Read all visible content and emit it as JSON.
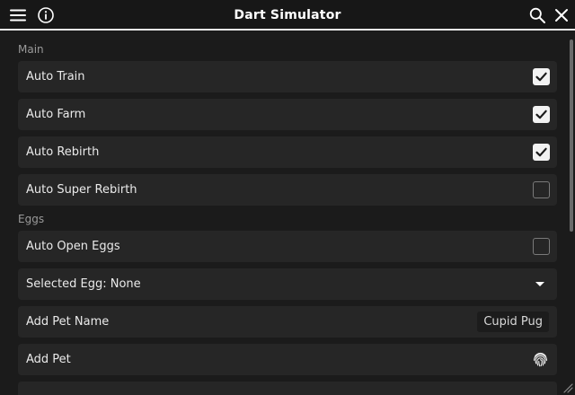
{
  "window": {
    "title": "Dart Simulator",
    "accent_color": "#e9e9e9",
    "background_color": "#1b1b1b",
    "row_color": "#262626"
  },
  "header_icons": [
    "menu-icon",
    "info-icon",
    "search-icon",
    "close-icon"
  ],
  "sections": {
    "main": {
      "label": "Main",
      "items": [
        {
          "label": "Auto Train",
          "type": "toggle",
          "checked": true
        },
        {
          "label": "Auto Farm",
          "type": "toggle",
          "checked": true
        },
        {
          "label": "Auto Rebirth",
          "type": "toggle",
          "checked": true
        },
        {
          "label": "Auto Super Rebirth",
          "type": "toggle",
          "checked": false
        }
      ]
    },
    "eggs": {
      "label": "Eggs",
      "items": [
        {
          "label": "Auto Open Eggs",
          "type": "toggle",
          "checked": false
        },
        {
          "label": "Selected Egg: None",
          "type": "dropdown",
          "icon": "chevron-down-icon"
        },
        {
          "label": "Add Pet Name",
          "type": "textbox",
          "value": "Cupid Pug"
        },
        {
          "label": "Add Pet",
          "type": "button",
          "icon": "fingerprint-icon"
        }
      ]
    }
  }
}
